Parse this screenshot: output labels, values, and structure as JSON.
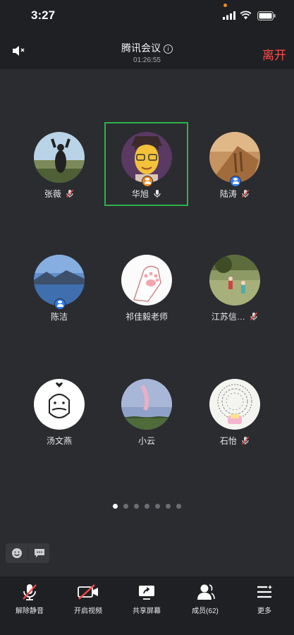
{
  "status_bar": {
    "time": "3:27"
  },
  "header": {
    "title": "腾讯会议",
    "info_icon": "i",
    "duration": "01:26:55",
    "leave_label": "离开"
  },
  "participants": [
    {
      "name": "张薇",
      "muted": true
    },
    {
      "name": "华旭",
      "muted": false,
      "speaking": true
    },
    {
      "name": "陆涛",
      "muted": true
    },
    {
      "name": "陈洁",
      "muted": false
    },
    {
      "name": "祁佳毅老师",
      "muted": false
    },
    {
      "name": "江苏信…",
      "muted": true
    },
    {
      "name": "汤文燕",
      "muted": false
    },
    {
      "name": "小云",
      "muted": false
    },
    {
      "name": "石怡",
      "muted": true
    }
  ],
  "pagination": {
    "pages": 7,
    "current": 1
  },
  "toolbar": {
    "unmute": "解除静音",
    "video": "开启视频",
    "share": "共享屏幕",
    "members": "成员(62)",
    "more": "更多"
  },
  "colors": {
    "leave": "#ff4a4a",
    "speaker_border": "#2ab34a",
    "host_badge": "#2e7cf6",
    "cohost_badge": "#f08a24"
  }
}
